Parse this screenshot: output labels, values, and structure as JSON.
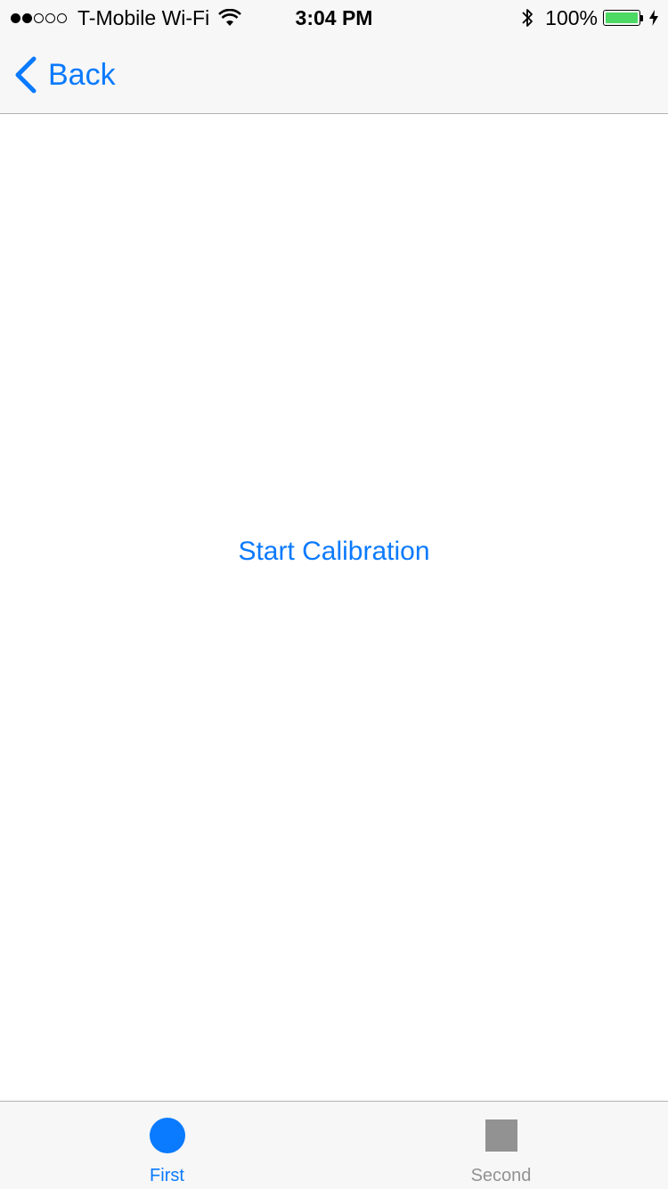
{
  "status_bar": {
    "carrier": "T-Mobile Wi-Fi",
    "signal_bars_filled": 2,
    "signal_bars_total": 5,
    "time": "3:04 PM",
    "battery_percent": "100%",
    "battery_level": 1.0,
    "battery_color": "#4cd964"
  },
  "nav": {
    "back_label": "Back"
  },
  "main": {
    "start_calibration_label": "Start Calibration"
  },
  "tab_bar": {
    "tabs": [
      {
        "label": "First",
        "icon": "circle-icon",
        "selected": true
      },
      {
        "label": "Second",
        "icon": "square-icon",
        "selected": false
      }
    ]
  },
  "colors": {
    "accent": "#0a7aff",
    "inactive": "#929292",
    "bar_background": "#f7f7f7"
  }
}
